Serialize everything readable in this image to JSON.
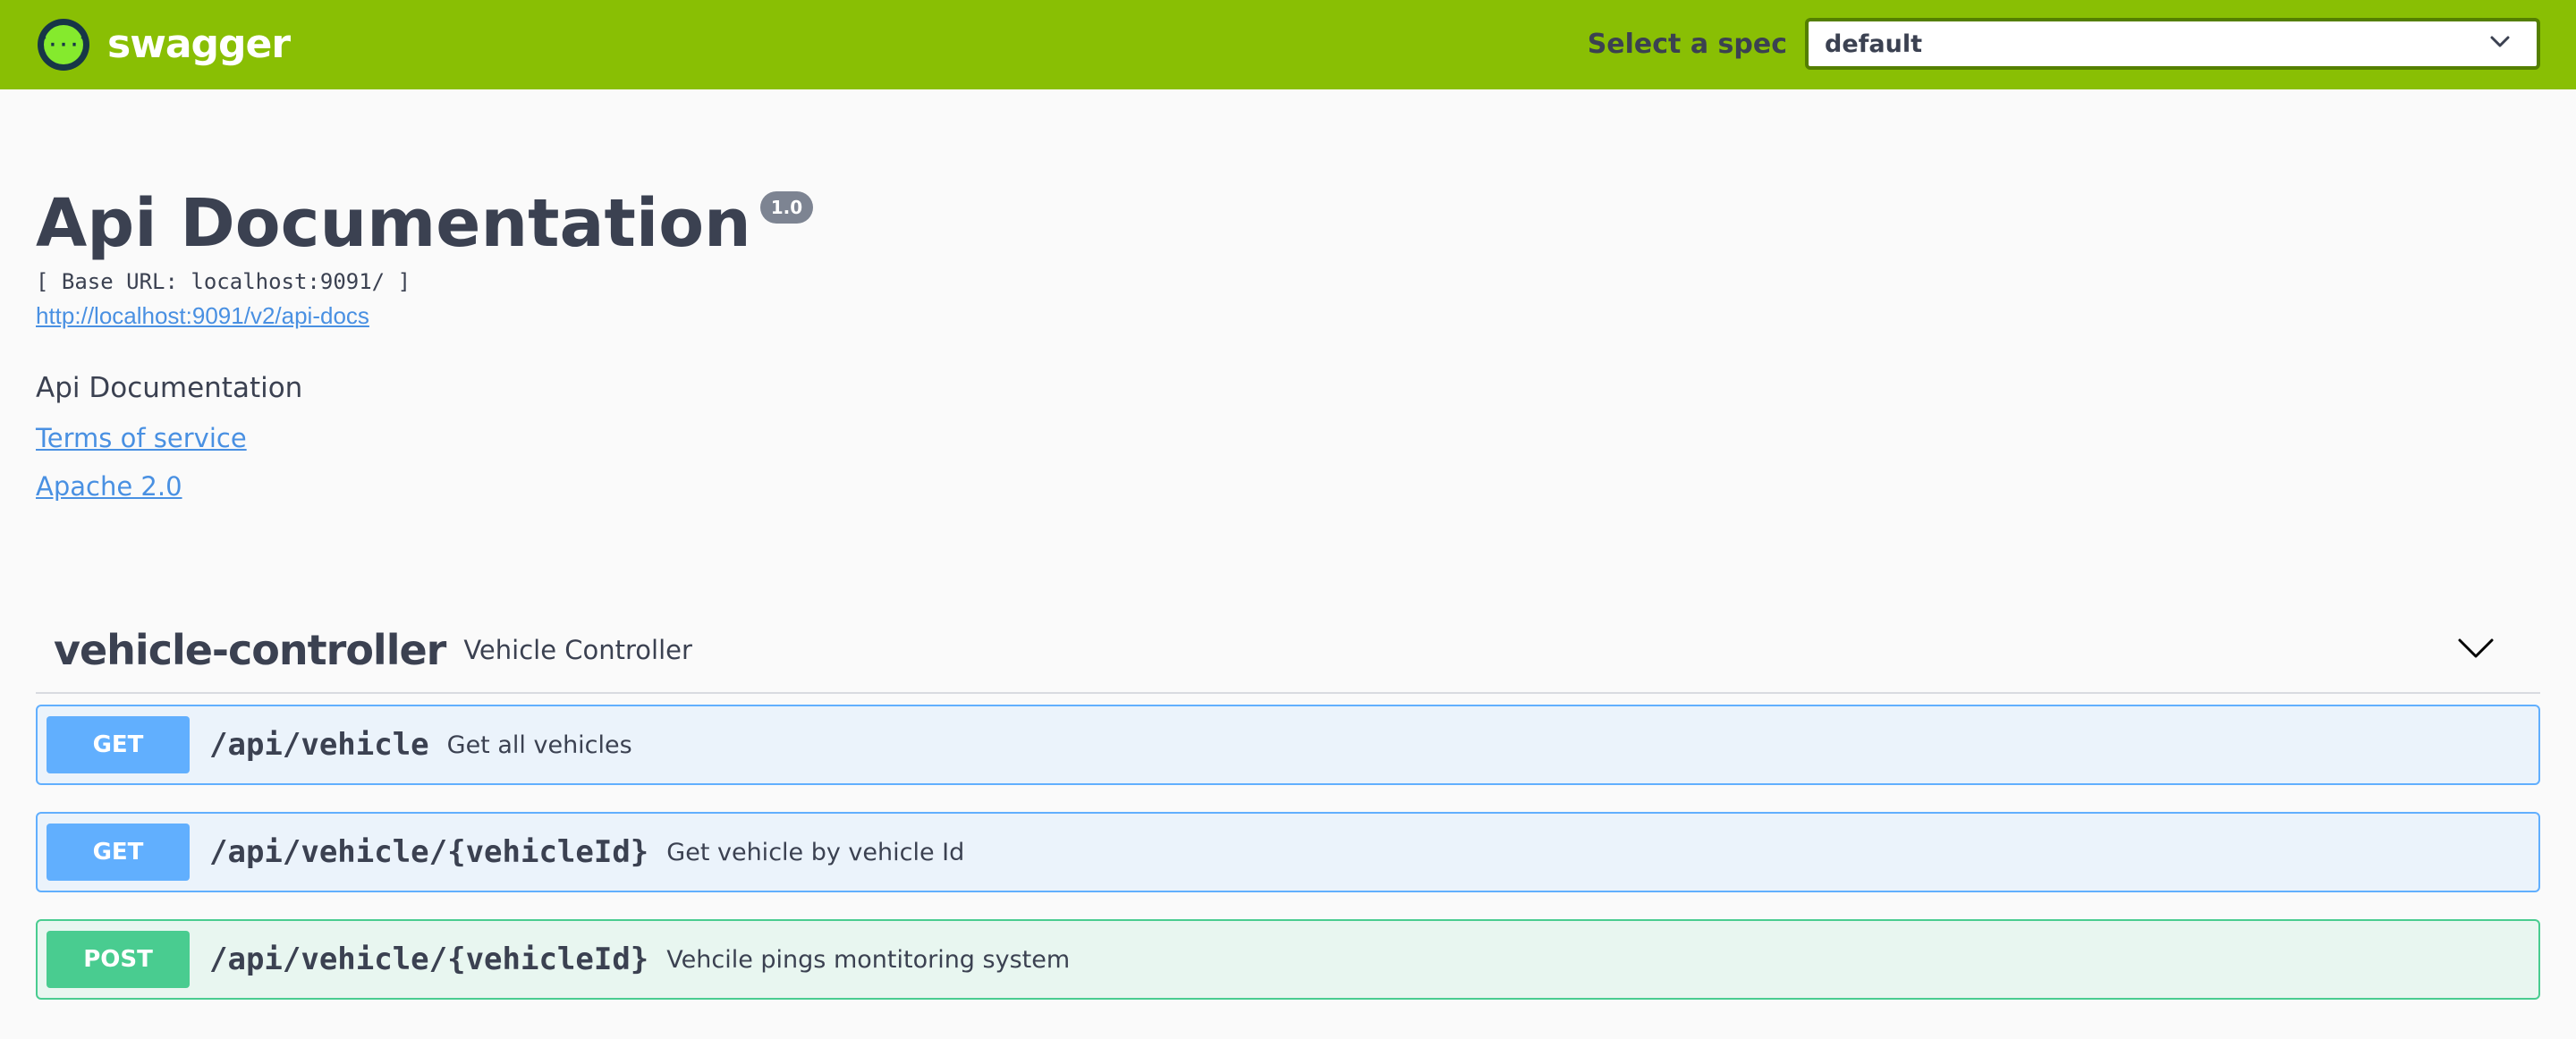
{
  "topbar": {
    "logo_text": "swagger",
    "logo_icon": "swagger-logo-icon",
    "spec_label": "Select a spec",
    "spec_selected": "default",
    "spec_icon": "chevron-down-icon",
    "background_color": "#89bf04"
  },
  "info": {
    "title": "Api Documentation",
    "version": "1.0",
    "base_url": "[ Base URL: localhost:9091/ ]",
    "docs_url": "http://localhost:9091/v2/api-docs",
    "description": "Api Documentation",
    "terms_label": "Terms of service",
    "license_label": "Apache 2.0"
  },
  "controller": {
    "name": "vehicle-controller",
    "description": "Vehicle Controller",
    "toggle_icon": "chevron-down-icon",
    "operations": [
      {
        "method": "GET",
        "path": "/api/vehicle",
        "summary": "Get all vehicles",
        "color": "#61affe"
      },
      {
        "method": "GET",
        "path": "/api/vehicle/{vehicleId}",
        "summary": "Get vehicle by vehicle Id",
        "color": "#61affe"
      },
      {
        "method": "POST",
        "path": "/api/vehicle/{vehicleId}",
        "summary": "Vehcile pings montitoring system",
        "color": "#49cc90"
      }
    ]
  }
}
